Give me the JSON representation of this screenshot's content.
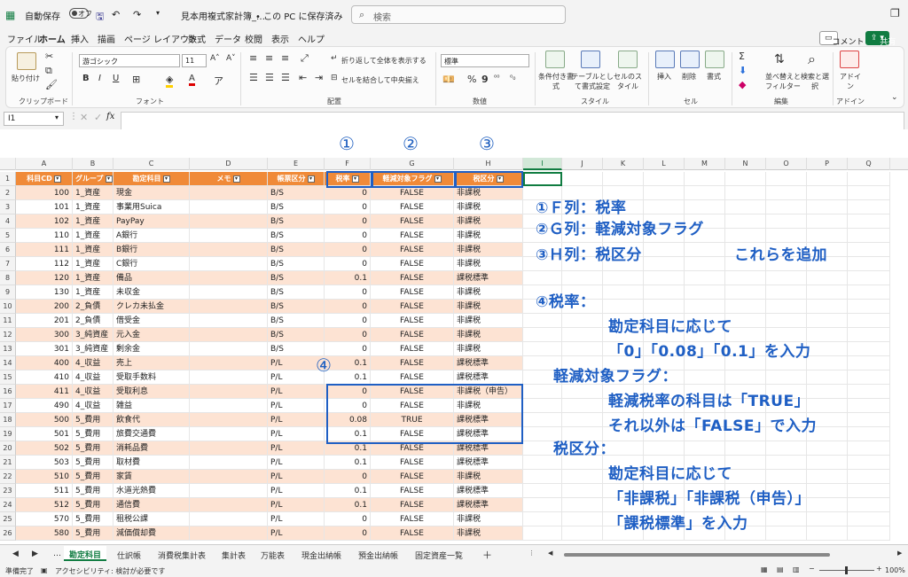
{
  "titlebar": {
    "autosave_label": "自動保存",
    "autosave_state": "オフ",
    "doc_title": "見本用複式家計簿_…",
    "save_state": "• この PC に保存済み",
    "search_placeholder": "検索"
  },
  "menu": {
    "tabs": [
      "ファイル",
      "ホーム",
      "挿入",
      "描画",
      "ページ レイアウト",
      "数式",
      "データ",
      "校閲",
      "表示",
      "ヘルプ"
    ],
    "active": "ホーム",
    "comment_btn": "コメント",
    "share_btn": "共有"
  },
  "ribbon": {
    "paste": "貼り付け",
    "font_name": "游ゴシック",
    "font_size": "11",
    "wrap_text": "折り返して全体を表示する",
    "merge_center": "セルを結合して中央揃え",
    "number_format": "標準",
    "cond_format": "条件付き書式",
    "table_format": "テーブルとして書式設定",
    "cell_style": "セルのスタイル",
    "insert": "挿入",
    "delete": "削除",
    "format": "書式",
    "sort_filter": "並べ替えとフィルター",
    "find_select": "検索と選択",
    "addin": "アドイン",
    "groups": [
      "クリップボード",
      "フォント",
      "配置",
      "数値",
      "スタイル",
      "セル",
      "編集",
      "アドイン"
    ]
  },
  "formula_bar": {
    "name_box": "I1",
    "fx": "fx"
  },
  "columns": [
    "A",
    "B",
    "C",
    "D",
    "E",
    "F",
    "G",
    "H",
    "I",
    "J",
    "K",
    "L",
    "M",
    "N",
    "O",
    "P",
    "Q"
  ],
  "selected_column": "I",
  "header": [
    "科目CD",
    "グループ",
    "勘定科目",
    "メモ",
    "帳票区分",
    "税率",
    "軽減対象フラグ",
    "税区分"
  ],
  "rows": [
    [
      "100",
      "1_資産",
      "現金",
      "",
      "B/S",
      "0",
      "FALSE",
      "非課税"
    ],
    [
      "101",
      "1_資産",
      "事業用Suica",
      "",
      "B/S",
      "0",
      "FALSE",
      "非課税"
    ],
    [
      "102",
      "1_資産",
      "PayPay",
      "",
      "B/S",
      "0",
      "FALSE",
      "非課税"
    ],
    [
      "110",
      "1_資産",
      "A銀行",
      "",
      "B/S",
      "0",
      "FALSE",
      "非課税"
    ],
    [
      "111",
      "1_資産",
      "B銀行",
      "",
      "B/S",
      "0",
      "FALSE",
      "非課税"
    ],
    [
      "112",
      "1_資産",
      "C銀行",
      "",
      "B/S",
      "0",
      "FALSE",
      "非課税"
    ],
    [
      "120",
      "1_資産",
      "備品",
      "",
      "B/S",
      "0.1",
      "FALSE",
      "課税標準"
    ],
    [
      "130",
      "1_資産",
      "未収金",
      "",
      "B/S",
      "0",
      "FALSE",
      "非課税"
    ],
    [
      "200",
      "2_負債",
      "クレカ未払金",
      "",
      "B/S",
      "0",
      "FALSE",
      "非課税"
    ],
    [
      "201",
      "2_負債",
      "借受金",
      "",
      "B/S",
      "0",
      "FALSE",
      "非課税"
    ],
    [
      "300",
      "3_純資産",
      "元入金",
      "",
      "B/S",
      "0",
      "FALSE",
      "非課税"
    ],
    [
      "301",
      "3_純資産",
      "剰余金",
      "",
      "B/S",
      "0",
      "FALSE",
      "非課税"
    ],
    [
      "400",
      "4_収益",
      "売上",
      "",
      "P/L",
      "0.1",
      "FALSE",
      "課税標準"
    ],
    [
      "410",
      "4_収益",
      "受取手数料",
      "",
      "P/L",
      "0.1",
      "FALSE",
      "課税標準"
    ],
    [
      "411",
      "4_収益",
      "受取利息",
      "",
      "P/L",
      "0",
      "FALSE",
      "非課税（申告）"
    ],
    [
      "490",
      "4_収益",
      "雑益",
      "",
      "P/L",
      "0",
      "FALSE",
      "非課税"
    ],
    [
      "500",
      "5_費用",
      "飲食代",
      "",
      "P/L",
      "0.08",
      "TRUE",
      "課税標準"
    ],
    [
      "501",
      "5_費用",
      "旅費交通費",
      "",
      "P/L",
      "0.1",
      "FALSE",
      "課税標準"
    ],
    [
      "502",
      "5_費用",
      "消耗品費",
      "",
      "P/L",
      "0.1",
      "FALSE",
      "課税標準"
    ],
    [
      "503",
      "5_費用",
      "取材費",
      "",
      "P/L",
      "0.1",
      "FALSE",
      "課税標準"
    ],
    [
      "510",
      "5_費用",
      "家賃",
      "",
      "P/L",
      "0",
      "FALSE",
      "非課税"
    ],
    [
      "511",
      "5_費用",
      "水道光熱費",
      "",
      "P/L",
      "0.1",
      "FALSE",
      "課税標準"
    ],
    [
      "512",
      "5_費用",
      "通信費",
      "",
      "P/L",
      "0.1",
      "FALSE",
      "課税標準"
    ],
    [
      "570",
      "5_費用",
      "租税公課",
      "",
      "P/L",
      "0",
      "FALSE",
      "非課税"
    ],
    [
      "580",
      "5_費用",
      "減価償却費",
      "",
      "P/L",
      "0",
      "FALSE",
      "非課税"
    ]
  ],
  "circled_numbers": [
    "①",
    "②",
    "③",
    "④"
  ],
  "annotations": [
    "①Ｆ列：税率",
    "②Ｇ列：軽減対象フラグ",
    "③Ｈ列：税区分",
    "これらを追加",
    "④税率：",
    "勘定科目に応じて",
    "「0」「0.08」「0.1」を入力",
    "軽減対象フラグ：",
    "軽減税率の科目は「TRUE」",
    "それ以外は「FALSE」で入力",
    "税区分：",
    "勘定科目に応じて",
    "「非課税」「非課税（申告）」",
    "「課税標準」を入力"
  ],
  "sheet_tabs": [
    "勘定科目",
    "仕訳帳",
    "消費税集計表",
    "集計表",
    "万能表",
    "現金出納帳",
    "預金出納帳",
    "固定資産一覧"
  ],
  "active_sheet": "勘定科目",
  "status": {
    "ready": "準備完了",
    "accessibility": "アクセシビリティ: 検討が必要です",
    "zoom": "100%"
  },
  "colors": {
    "header_orange": "#f08a38",
    "row_band": "#fde3d3",
    "accent_green": "#107c41",
    "annotation_blue": "#1f5fc4"
  }
}
